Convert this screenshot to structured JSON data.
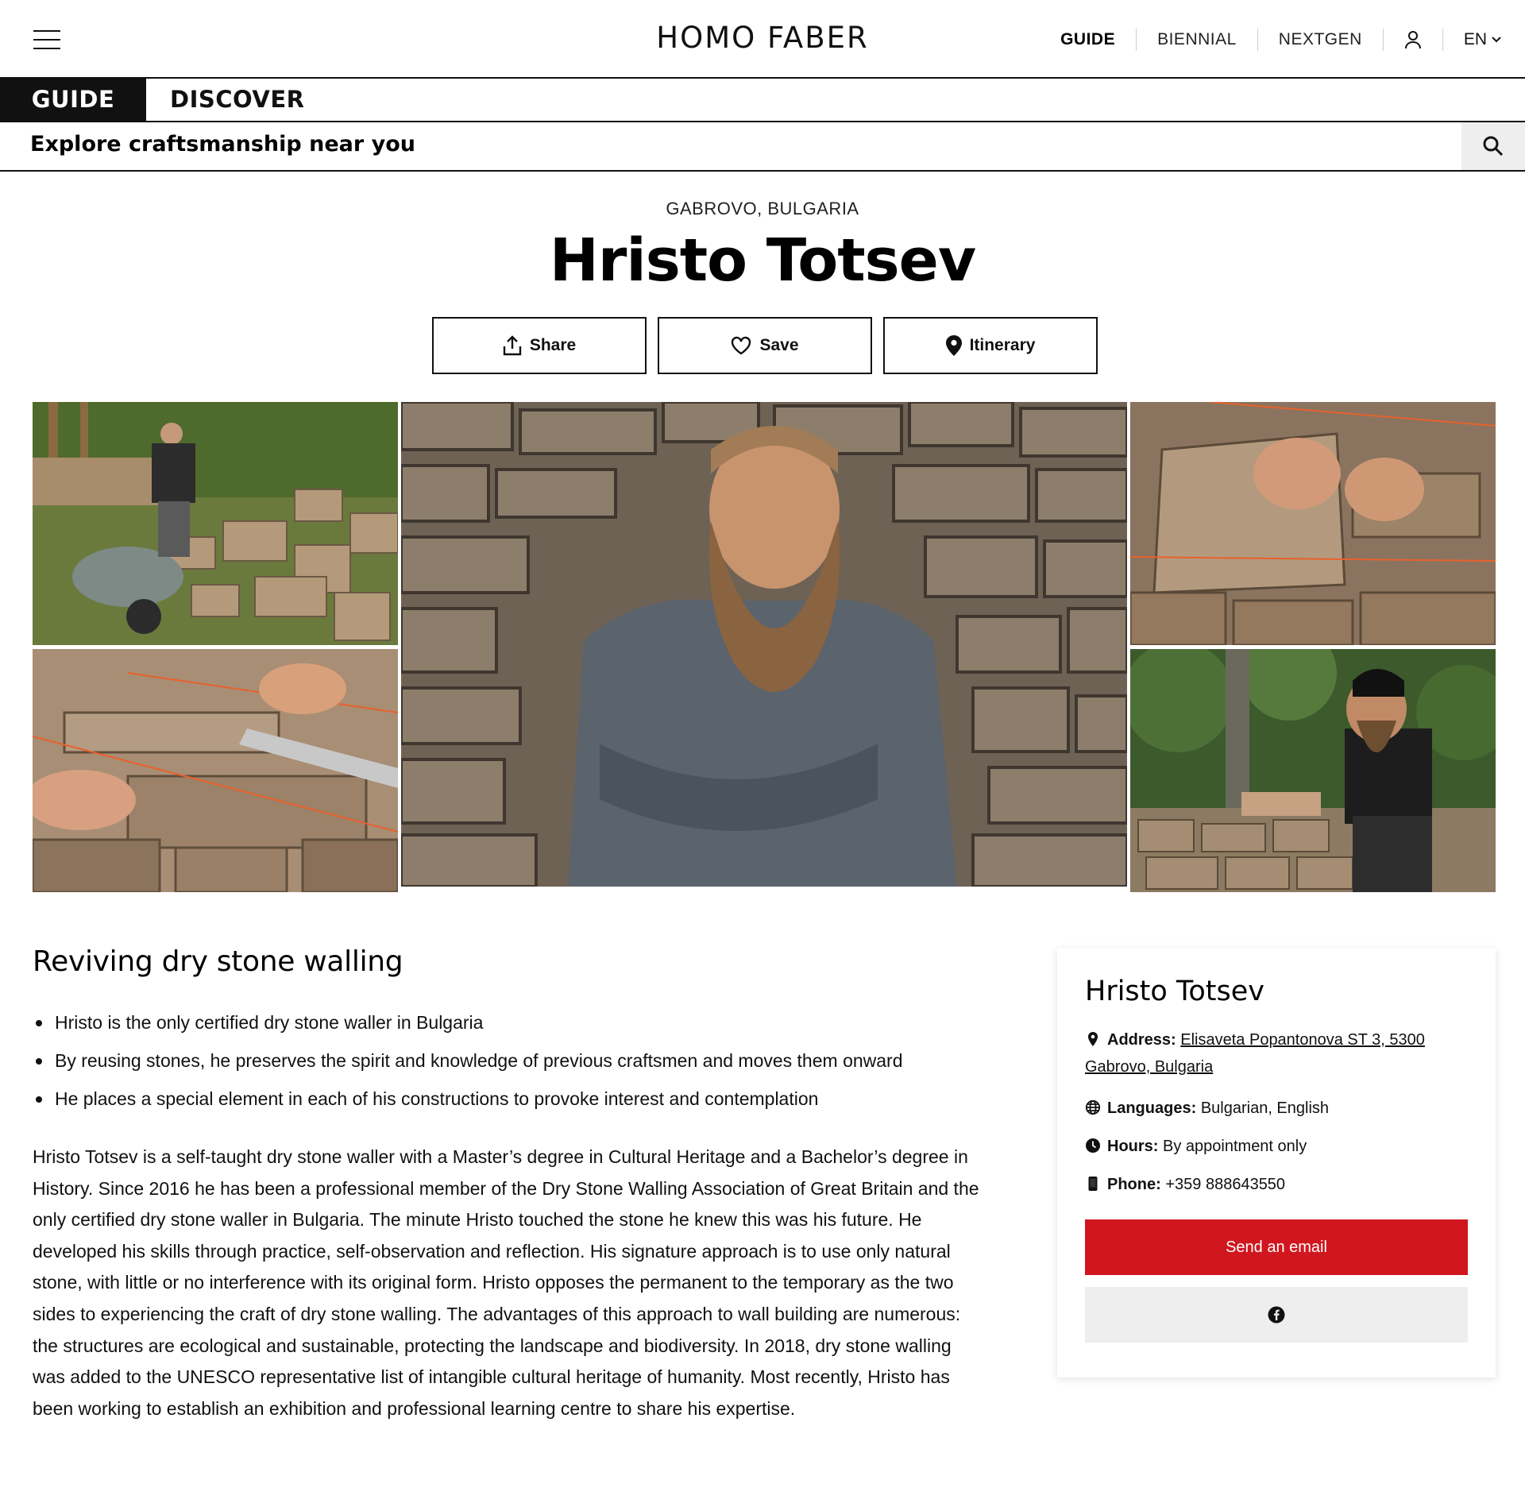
{
  "header": {
    "logo": "HOMO FABER",
    "nav": [
      "GUIDE",
      "BIENNIAL",
      "NEXTGEN"
    ],
    "active_nav": "GUIDE",
    "language": "EN"
  },
  "tabs": {
    "guide": "GUIDE",
    "discover": "DISCOVER"
  },
  "explore": {
    "label": "Explore craftsmanship near you"
  },
  "profile": {
    "location": "GABROVO, BULGARIA",
    "name": "Hristo Totsev",
    "actions": {
      "share": "Share",
      "save": "Save",
      "itinerary": "Itinerary"
    }
  },
  "article": {
    "heading": "Reviving dry stone walling",
    "bullets": [
      "Hristo is the only certified dry stone waller in Bulgaria",
      "By reusing stones, he preserves the spirit and knowledge of previous craftsmen and moves them onward",
      "He places a special element in each of his constructions to provoke interest and contemplation"
    ],
    "body": "Hristo Totsev is a self-taught dry stone waller with a Master’s degree in Cultural Heritage and a Bachelor’s degree in History. Since 2016 he has been a professional member of the Dry Stone Walling Association of Great Britain and the only certified dry stone waller in Bulgaria. The minute Hristo touched the stone he knew this was his future. He developed his skills through practice, self-observation and reflection. His signature approach is to use only natural stone, with little or no interference with its original form. Hristo opposes the permanent to the temporary as the two sides to experiencing the craft of dry stone walling. The advantages of this approach to wall building are numerous: the structures are ecological and sustainable, protecting the landscape and biodiversity. In 2018, dry stone walling was added to the UNESCO representative list of intangible cultural heritage of humanity. Most recently, Hristo has been working to establish an exhibition and professional learning centre to share his expertise."
  },
  "card": {
    "name": "Hristo Totsev",
    "address_label": "Address:",
    "address": "Elisaveta Popantonova ST 3, 5300 Gabrovo, Bulgaria",
    "languages_label": "Languages:",
    "languages": "Bulgarian, English",
    "hours_label": "Hours:",
    "hours": "By appointment only",
    "phone_label": "Phone:",
    "phone": "+359 888643550",
    "email_button": "Send an email",
    "social_icon": "facebook-icon"
  },
  "colors": {
    "accent_red": "#d0161f",
    "ink": "#111111",
    "light_gray": "#eeeeee"
  }
}
